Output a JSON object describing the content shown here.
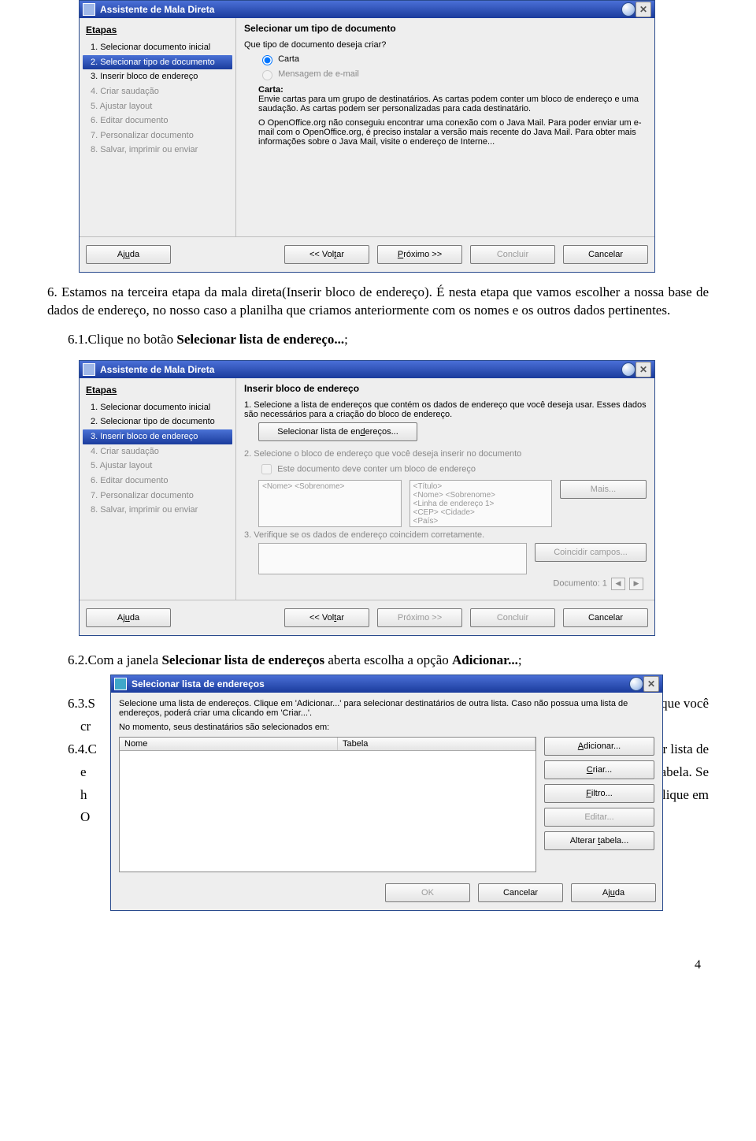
{
  "window1": {
    "title": "Assistente de Mala Direta",
    "steps_header": "Etapas",
    "steps": [
      "1. Selecionar documento inicial",
      "2. Selecionar tipo de documento",
      "3. Inserir bloco de endereço",
      "4. Criar saudação",
      "5. Ajustar layout",
      "6. Editar documento",
      "7. Personalizar documento",
      "8. Salvar, imprimir ou enviar"
    ],
    "pane_header": "Selecionar um tipo de documento",
    "question": "Que tipo de documento deseja criar?",
    "opt_carta": "Carta",
    "opt_email": "Mensagem de e-mail",
    "carta_hdr": "Carta:",
    "carta_text": "Envie cartas para um grupo de destinatários. As cartas podem conter um bloco de endereço e uma saudação. As cartas podem ser personalizadas para cada destinatário.",
    "java_text": "O OpenOffice.org não conseguiu encontrar uma conexão com o Java Mail. Para poder enviar um e-mail com o OpenOffice.org, é preciso instalar a versão mais recente do Java Mail. Para obter mais informações sobre o Java Mail, visite o endereço de Interne...",
    "btn_help": "Ajuda",
    "btn_back": "<< Voltar",
    "btn_next": "Próximo >>",
    "btn_finish": "Concluir",
    "btn_cancel": "Cancelar"
  },
  "para6": "6. Estamos na terceira etapa da mala direta(Inserir bloco de endereço). É nesta etapa que vamos escolher a nossa base de dados de endereço, no nosso caso a planilha que criamos anteriormente com os nomes e os outros dados pertinentes.",
  "para61_a": "6.1.Clique no botão ",
  "para61_b": "Selecionar lista de endereço...",
  "para61_c": ";",
  "window2": {
    "title": "Assistente de Mala Direta",
    "steps_header": "Etapas",
    "steps": [
      "1. Selecionar documento inicial",
      "2. Selecionar tipo de documento",
      "3. Inserir bloco de endereço",
      "4. Criar saudação",
      "5. Ajustar layout",
      "6. Editar documento",
      "7. Personalizar documento",
      "8. Salvar, imprimir ou enviar"
    ],
    "pane_header": "Inserir bloco de endereço",
    "step1_text": "1. Selecione a lista de endereços que contém os dados de endereço que você deseja usar. Esses dados são necessários para a criação do bloco de endereço.",
    "btn_select_list": "Selecionar lista de endereços...",
    "step2_text": "2. Selecione o bloco de endereço que você deseja inserir no documento",
    "chk_label": "Este documento deve conter um bloco de endereço",
    "box1": "<Nome> <Sobrenome>",
    "box2": "<Título>\n<Nome> <Sobrenome>\n<Linha de endereço 1>\n<CEP> <Cidade>\n<País>",
    "btn_mais": "Mais...",
    "step3_text": "3. Verifique se os dados de endereço coincidem corretamente.",
    "btn_match": "Coincidir campos...",
    "doc_label": "Documento: 1",
    "btn_help": "Ajuda",
    "btn_back": "<< Voltar",
    "btn_next": "Próximo >>",
    "btn_finish": "Concluir",
    "btn_cancel": "Cancelar"
  },
  "para62_a": "6.2.Com a janela  ",
  "para62_b": "Selecionar lista de endereços",
  "para62_c": " aberta escolha a opção ",
  "para62_d": "Adicionar...",
  "para62_e": ";",
  "behind": {
    "p63_a": "6.3.S",
    "p63_b": "  que  você",
    "p63_c": "cr",
    "p64_a": "6.4.C",
    "p64_b": "ar lista de",
    "p64_c": "e",
    "p64_d": "Tabela",
    "p64_e": ". Se",
    "p64_f": "h",
    "p64_g": "clique em",
    "p64_h": "O"
  },
  "window3": {
    "title": "Selecionar lista de endereços",
    "intro": "Selecione uma lista de endereços. Clique em 'Adicionar...' para selecionar destinatários de outra lista. Caso não possua uma lista de endereços, poderá criar uma clicando em 'Criar...'.",
    "now": "No momento, seus destinatários são selecionados em:",
    "col1": "Nome",
    "col2": "Tabela",
    "btn_add": "Adicionar...",
    "btn_create": "Criar...",
    "btn_filter": "Filtro...",
    "btn_edit": "Editar...",
    "btn_change": "Alterar tabela...",
    "btn_ok": "OK",
    "btn_cancel": "Cancelar",
    "btn_help": "Ajuda"
  },
  "pagenum": "4"
}
